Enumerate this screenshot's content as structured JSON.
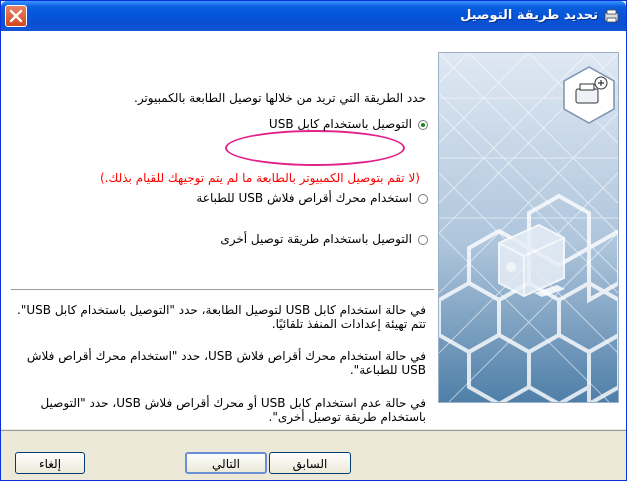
{
  "window": {
    "title": "تحديد طريقة التوصيل"
  },
  "main": {
    "prompt": "حدد الطريقة التي تريد من خلالها توصيل الطابعة بالكمبيوتر.",
    "options": [
      {
        "label": "التوصيل باستخدام كابل USB",
        "selected": true
      },
      {
        "label": "استخدام محرك أقراص فلاش USB للطباعة",
        "selected": false
      },
      {
        "label": "التوصيل باستخدام طريقة توصيل أخرى",
        "selected": false
      }
    ],
    "warning": "(لا تقم بتوصيل الكمبيوتر بالطابعة ما لم يتم توجيهك للقيام بذلك.)",
    "warning_color": "#ff0000",
    "highlight_color": "#e0228a",
    "descriptions": [
      "في حالة استخدام كابل USB لتوصيل الطابعة، حدد \"التوصيل باستخدام كابل USB\". تتم تهيئة إعدادات المنفذ تلقائيًا.",
      "في حالة استخدام محرك أقراص فلاش USB، حدد \"استخدام محرك أقراص فلاش USB للطباعة\".",
      "في حالة عدم استخدام كابل USB أو محرك أقراص فلاش USB، حدد \"التوصيل باستخدام طريقة توصيل أخرى\"."
    ]
  },
  "buttons": {
    "back": "السابق",
    "next": "التالي",
    "cancel": "إلغاء"
  },
  "icons": [
    "close-icon",
    "printer-connection-icon",
    "printer-graphic"
  ]
}
